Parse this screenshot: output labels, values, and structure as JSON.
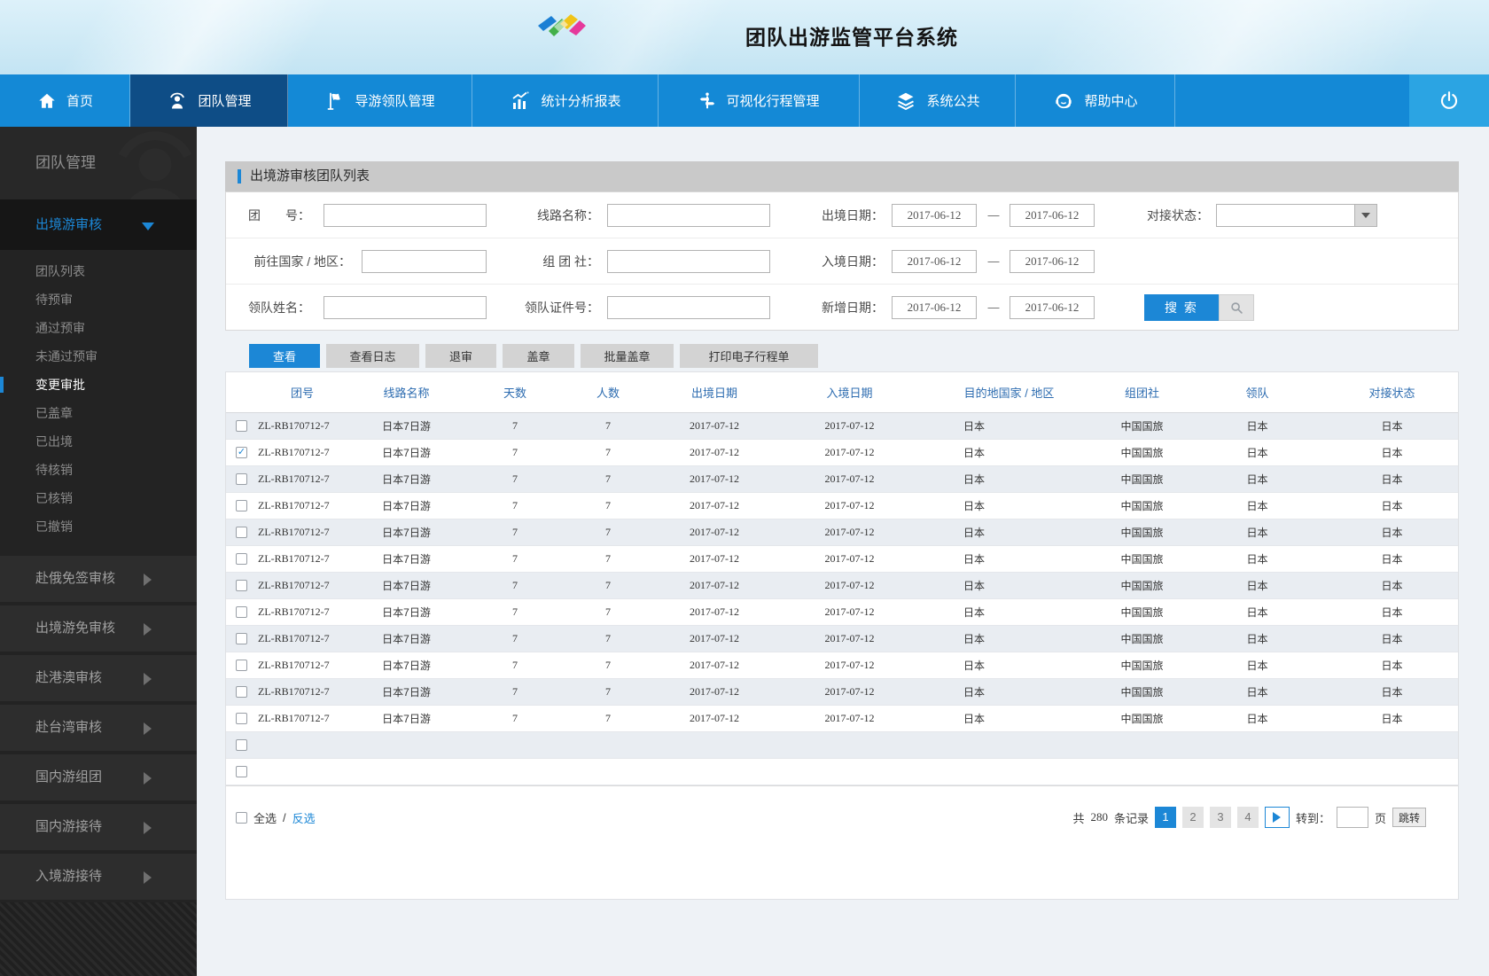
{
  "header": {
    "title": "团队出游监管平台系统"
  },
  "nav": {
    "items": [
      {
        "label": "首页",
        "icon": "home-icon",
        "active": false
      },
      {
        "label": "团队管理",
        "icon": "team-icon",
        "active": true
      },
      {
        "label": "导游领队管理",
        "icon": "flag-icon",
        "active": false
      },
      {
        "label": "统计分析报表",
        "icon": "chart-icon",
        "active": false
      },
      {
        "label": "可视化行程管理",
        "icon": "route-icon",
        "active": false
      },
      {
        "label": "系统公共",
        "icon": "layers-icon",
        "active": false
      },
      {
        "label": "帮助中心",
        "icon": "help-icon",
        "active": false
      }
    ],
    "power_icon": "power-icon"
  },
  "sidebar": {
    "title": "团队管理",
    "expanded_group": {
      "label": "出境游审核"
    },
    "submenu": [
      {
        "label": "团队列表",
        "active": false
      },
      {
        "label": "待预审",
        "active": false
      },
      {
        "label": "通过预审",
        "active": false
      },
      {
        "label": "未通过预审",
        "active": false
      },
      {
        "label": "变更审批",
        "active": true
      },
      {
        "label": "已盖章",
        "active": false
      },
      {
        "label": "已出境",
        "active": false
      },
      {
        "label": "待核销",
        "active": false
      },
      {
        "label": "已核销",
        "active": false
      },
      {
        "label": "已撤销",
        "active": false
      }
    ],
    "groups": [
      "赴俄免签审核",
      "出境游免审核",
      "赴港澳审核",
      "赴台湾审核",
      "国内游组团",
      "国内游接待",
      "入境游接待"
    ]
  },
  "panel": {
    "title": "出境游审核团队列表",
    "form": {
      "row1": {
        "f1_label": "团　　号：",
        "f2_label": "线路名称：",
        "f3_label": "出境日期：",
        "f3_from": "2017-06-12",
        "dash": "—",
        "f3_to": "2017-06-12",
        "f4_label": "对接状态："
      },
      "row2": {
        "f1_label": "前往国家 / 地区：",
        "f2_label": "组 团 社：",
        "f3_label": "入境日期：",
        "f3_from": "2017-06-12",
        "dash": "—",
        "f3_to": "2017-06-12"
      },
      "row3": {
        "f1_label": "领队姓名：",
        "f2_label": "领队证件号：",
        "f3_label": "新增日期：",
        "f3_from": "2017-06-12",
        "dash": "—",
        "f3_to": "2017-06-12",
        "search_label": "搜 索"
      }
    },
    "actions": [
      {
        "label": "查看",
        "active": true
      },
      {
        "label": "查看日志",
        "active": false
      },
      {
        "label": "退审",
        "active": false
      },
      {
        "label": "盖章",
        "active": false
      },
      {
        "label": "批量盖章",
        "active": false
      },
      {
        "label": "打印电子行程单",
        "active": false
      }
    ],
    "table": {
      "columns": [
        "团号",
        "线路名称",
        "天数",
        "人数",
        "出境日期",
        "入境日期",
        "目的地国家 / 地区",
        "组团社",
        "领队",
        "对接状态"
      ],
      "rows": [
        [
          "ZL-RB170712-7",
          "日本7日游",
          "7",
          "7",
          "2017-07-12",
          "2017-07-12",
          "日本",
          "中国国旅",
          "日本",
          "日本"
        ],
        [
          "ZL-RB170712-7",
          "日本7日游",
          "7",
          "7",
          "2017-07-12",
          "2017-07-12",
          "日本",
          "中国国旅",
          "日本",
          "日本"
        ],
        [
          "ZL-RB170712-7",
          "日本7日游",
          "7",
          "7",
          "2017-07-12",
          "2017-07-12",
          "日本",
          "中国国旅",
          "日本",
          "日本"
        ],
        [
          "ZL-RB170712-7",
          "日本7日游",
          "7",
          "7",
          "2017-07-12",
          "2017-07-12",
          "日本",
          "中国国旅",
          "日本",
          "日本"
        ],
        [
          "ZL-RB170712-7",
          "日本7日游",
          "7",
          "7",
          "2017-07-12",
          "2017-07-12",
          "日本",
          "中国国旅",
          "日本",
          "日本"
        ],
        [
          "ZL-RB170712-7",
          "日本7日游",
          "7",
          "7",
          "2017-07-12",
          "2017-07-12",
          "日本",
          "中国国旅",
          "日本",
          "日本"
        ],
        [
          "ZL-RB170712-7",
          "日本7日游",
          "7",
          "7",
          "2017-07-12",
          "2017-07-12",
          "日本",
          "中国国旅",
          "日本",
          "日本"
        ],
        [
          "ZL-RB170712-7",
          "日本7日游",
          "7",
          "7",
          "2017-07-12",
          "2017-07-12",
          "日本",
          "中国国旅",
          "日本",
          "日本"
        ],
        [
          "ZL-RB170712-7",
          "日本7日游",
          "7",
          "7",
          "2017-07-12",
          "2017-07-12",
          "日本",
          "中国国旅",
          "日本",
          "日本"
        ],
        [
          "ZL-RB170712-7",
          "日本7日游",
          "7",
          "7",
          "2017-07-12",
          "2017-07-12",
          "日本",
          "中国国旅",
          "日本",
          "日本"
        ],
        [
          "ZL-RB170712-7",
          "日本7日游",
          "7",
          "7",
          "2017-07-12",
          "2017-07-12",
          "日本",
          "中国国旅",
          "日本",
          "日本"
        ],
        [
          "ZL-RB170712-7",
          "日本7日游",
          "7",
          "7",
          "2017-07-12",
          "2017-07-12",
          "日本",
          "中国国旅",
          "日本",
          "日本"
        ]
      ],
      "checked_row_index": 1,
      "empty_row_count": 2
    },
    "footer": {
      "select_all_label": "全选",
      "separator": "/",
      "invert_label": "反选",
      "records_prefix": "共",
      "records_count": "280",
      "records_suffix": "条记录",
      "pages": [
        "1",
        "2",
        "3",
        "4"
      ],
      "active_page": "1",
      "goto_label": "转到：",
      "page_suffix": "页",
      "jump_label": "跳转"
    }
  },
  "colors": {
    "accent_blue": "#1c87d6",
    "nav_blue": "#1489d6",
    "nav_active": "#0e4d86",
    "power_blue": "#2ba4e3",
    "row_alt": "#e9edf2",
    "header_text_blue": "#2d6cb0"
  }
}
